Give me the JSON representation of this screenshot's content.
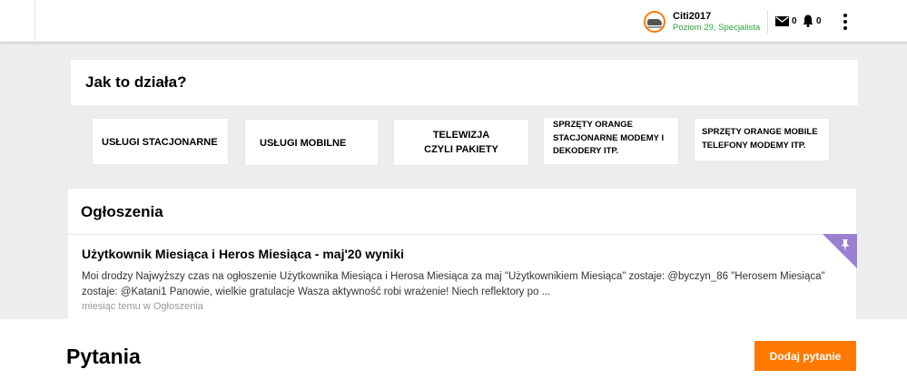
{
  "header": {
    "username": "Citi2017",
    "level": "Poziom 29, Specjalista",
    "messages_count": "0",
    "notifications_count": "0",
    "icons": [
      "avatar",
      "envelope-icon",
      "bell-icon",
      "more-vertical-icon"
    ],
    "colors": {
      "accent": "#ff7900",
      "level": "#2aa63a"
    }
  },
  "how_it_works": {
    "title": "Jak to działa?",
    "categories": [
      "USŁUGI STACJONARNE",
      "USŁUGI MOBILNE",
      "TELEWIZJA\nCZYLI PAKIETY",
      "SPRZĘTY ORANGE\nSTACJONARNE MODEMY I\nDEKODERY ITP.",
      "SPRZĘTY ORANGE MOBILE\nTELEFONY MODEMY ITP."
    ]
  },
  "announcements": {
    "title": "Ogłoszenia",
    "post": {
      "title": "Użytkownik Miesiąca i Heros Miesiąca - maj'20 wyniki",
      "body": "Moi drodzy Najwyższy czas na ogłoszenie Użytkownika Miesiąca i Herosa Miesiąca za maj \"Użytkownikiem Miesiąca\" zostaje: @byczyn_86 \"Herosem Miesiąca\" zostaje: @Katani1 Panowie, wielkie gratulacje Wasza aktywność robi wrażenie! Niech reflektory po ...",
      "meta": "miesiąc temu w Ogłoszenia",
      "pin_color": "#9b7fd1"
    }
  },
  "questions": {
    "title": "Pytania",
    "add_button": "Dodaj pytanie"
  }
}
